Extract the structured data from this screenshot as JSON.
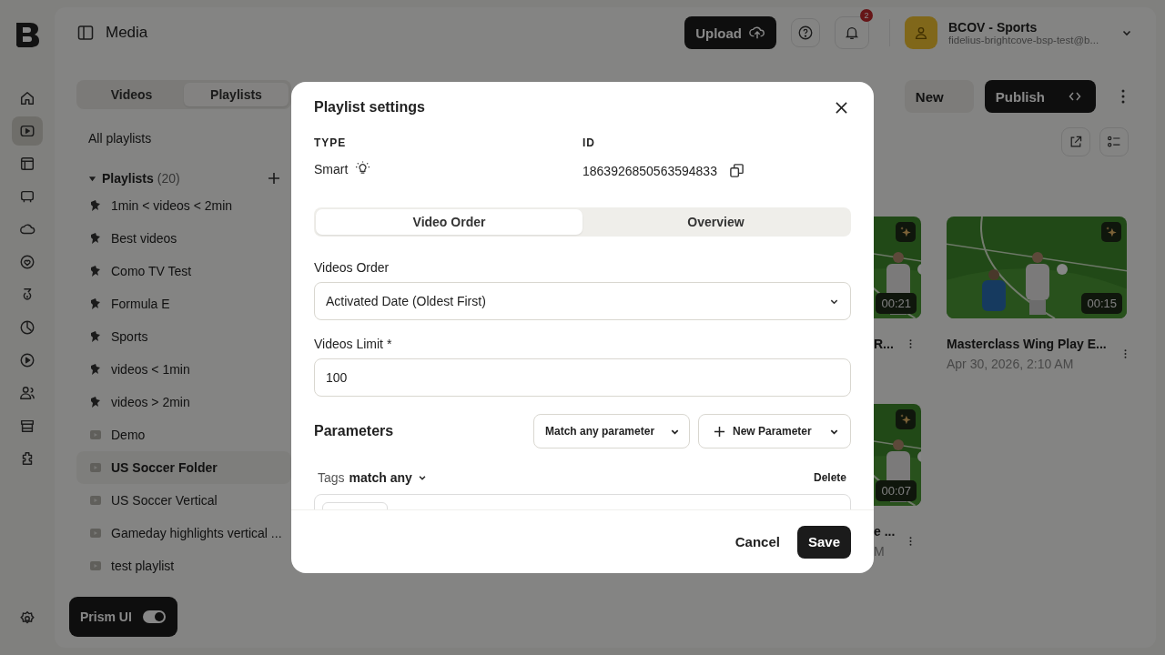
{
  "header": {
    "title": "Media",
    "upload": "Upload",
    "notifications": "2",
    "account": {
      "name": "BCOV - Sports",
      "email": "fidelius-brightcove-bsp-test@b..."
    }
  },
  "rail_items": [
    {
      "selected": false
    },
    {
      "selected": true
    },
    {
      "selected": false
    },
    {
      "selected": false
    },
    {
      "selected": false
    },
    {
      "selected": false
    },
    {
      "selected": false
    },
    {
      "selected": false
    },
    {
      "selected": false
    },
    {
      "selected": false
    },
    {
      "selected": false
    },
    {
      "selected": false
    }
  ],
  "tabs": [
    {
      "label": "Videos",
      "selected": false
    },
    {
      "label": "Playlists",
      "selected": true
    }
  ],
  "all_playlists": "All playlists",
  "playlists_group": {
    "label": "Playlists",
    "count": "(20)",
    "expanded": true,
    "items": [
      {
        "label": "1min < videos < 2min",
        "kind": "smart",
        "selected": false
      },
      {
        "label": "Best videos",
        "kind": "smart",
        "selected": false
      },
      {
        "label": "Como TV Test",
        "kind": "smart",
        "selected": false
      },
      {
        "label": "Formula E",
        "kind": "smart",
        "selected": false
      },
      {
        "label": "Sports",
        "kind": "smart",
        "selected": false
      },
      {
        "label": "videos < 1min",
        "kind": "smart",
        "selected": false
      },
      {
        "label": "videos > 2min",
        "kind": "smart",
        "selected": false
      },
      {
        "label": "Demo",
        "kind": "folder",
        "selected": false
      },
      {
        "label": "US Soccer Folder",
        "kind": "folder",
        "selected": true
      },
      {
        "label": "US Soccer Vertical",
        "kind": "folder",
        "selected": false
      },
      {
        "label": "Gameday highlights vertical ...",
        "kind": "folder",
        "selected": false
      },
      {
        "label": "test playlist",
        "kind": "folder",
        "selected": false
      }
    ]
  },
  "prism_toggle": {
    "label": "Prism UI",
    "on": true
  },
  "toolbar": {
    "new": "New",
    "publish": "Publish"
  },
  "videos": [
    {
      "title": "R...",
      "duration": "00:21"
    },
    {
      "title": "Masterclass Wing Play E...",
      "date": "Apr 30, 2026, 2:10 AM",
      "duration": "00:15"
    },
    {
      "title": "e ...",
      "date": "M",
      "duration": "00:07"
    }
  ],
  "dialog": {
    "title": "Playlist settings",
    "type_label": "TYPE",
    "type_value": "Smart",
    "id_label": "ID",
    "id_value": "1863926850563594833",
    "tabs": [
      {
        "label": "Video Order",
        "selected": true
      },
      {
        "label": "Overview",
        "selected": false
      }
    ],
    "order_label": "Videos Order",
    "order_value": "Activated Date (Oldest First)",
    "limit_label": "Videos Limit *",
    "limit_value": "100",
    "parameters_title": "Parameters",
    "match_button": "Match any parameter",
    "new_parameter": "New Parameter",
    "tags_label": "Tags",
    "tags_match": "match any",
    "delete": "Delete",
    "cancel": "Cancel",
    "save": "Save"
  }
}
